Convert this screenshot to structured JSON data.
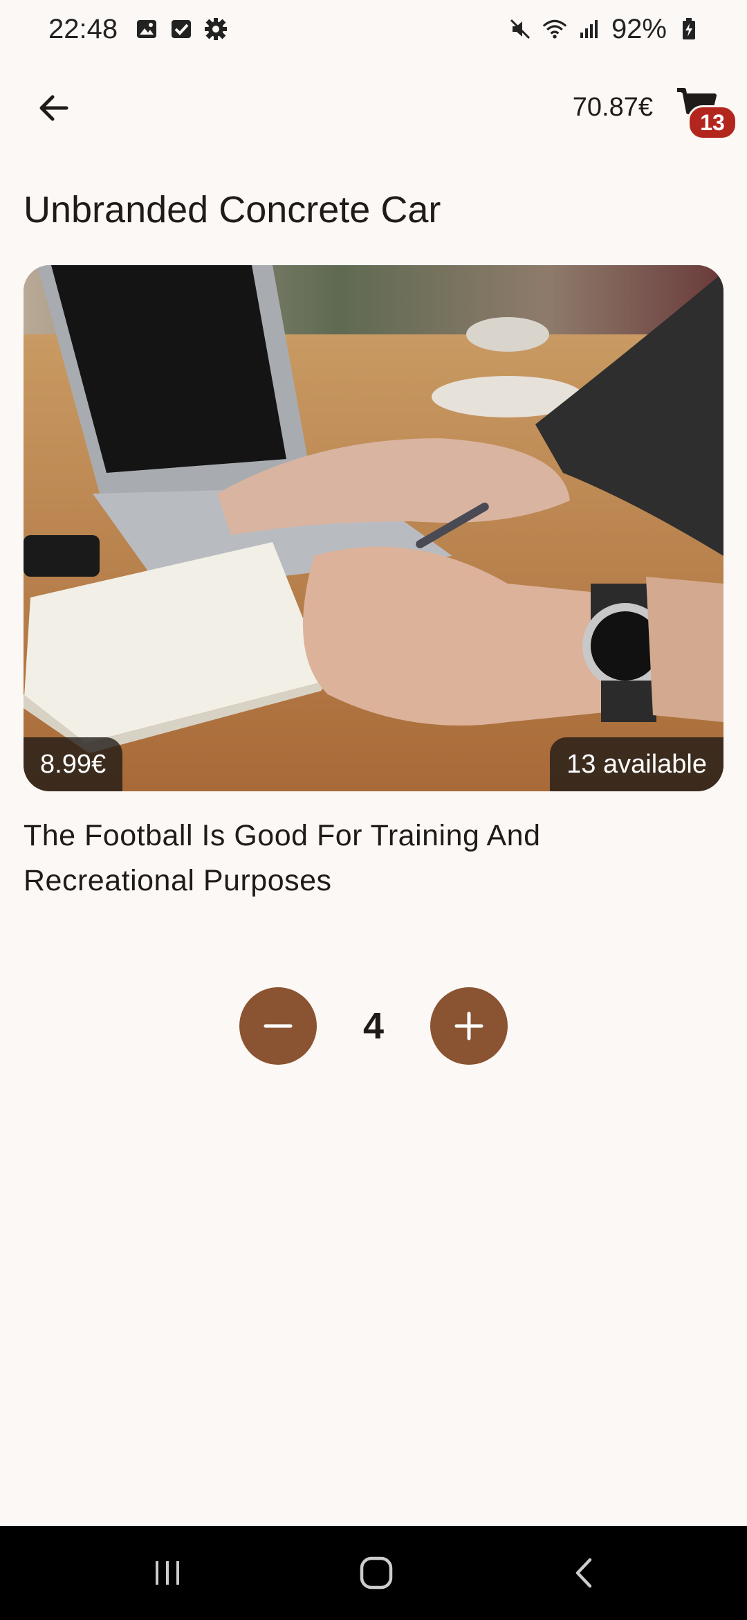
{
  "status_bar": {
    "time": "22:48",
    "battery": "92%",
    "left_icons": [
      "gallery-icon",
      "checkbox-icon",
      "settings-gear-icon"
    ],
    "right_icons": [
      "mute-icon",
      "wifi-icon",
      "signal-icon",
      "battery-charging-icon"
    ]
  },
  "app_bar": {
    "back_icon": "arrow-left-icon",
    "cart_total": "70.87€",
    "cart_icon": "shopping-cart-icon",
    "cart_count": "13"
  },
  "product": {
    "title": "Unbranded Concrete Car",
    "price": "8.99€",
    "availability": "13 available",
    "description": "The Football Is Good For Training And Recreational Purposes"
  },
  "quantity": {
    "value": "4",
    "decrement_icon": "minus-icon",
    "increment_icon": "plus-icon"
  },
  "nav_bar": {
    "icons": [
      "recent-apps-icon",
      "home-icon",
      "back-chevron-icon"
    ]
  },
  "colors": {
    "background": "#fcf8f5",
    "accent": "#8a5331",
    "badge": "#b3261e",
    "text": "#1f1b18"
  }
}
